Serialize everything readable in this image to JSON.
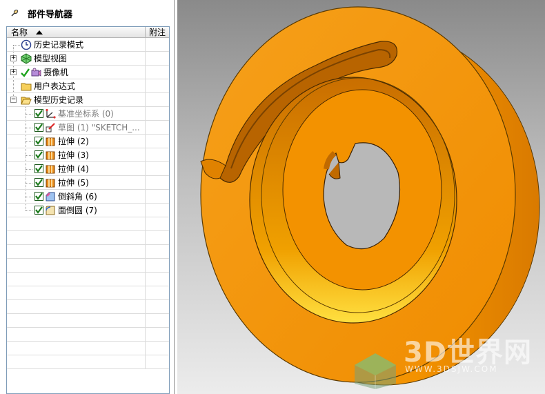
{
  "navigator": {
    "title": "部件导航器",
    "columns": {
      "name": "名称",
      "note": "附注"
    },
    "rows": [
      {
        "label": "历史记录模式",
        "icon": "clock-icon"
      },
      {
        "label": "模型视图",
        "icon": "model-views-icon"
      },
      {
        "label": "摄像机",
        "icon": "camera-icon"
      },
      {
        "label": "用户表达式",
        "icon": "folder-icon"
      },
      {
        "label": "模型历史记录",
        "icon": "folder-open-icon"
      },
      {
        "label": "基准坐标系 (0)",
        "icon": "datum-csys-icon"
      },
      {
        "label": "草图 (1) \"SKETCH_...",
        "icon": "sketch-icon"
      },
      {
        "label": "拉伸 (2)",
        "icon": "extrude-icon"
      },
      {
        "label": "拉伸 (3)",
        "icon": "extrude-icon"
      },
      {
        "label": "拉伸 (4)",
        "icon": "extrude-icon"
      },
      {
        "label": "拉伸 (5)",
        "icon": "extrude-icon"
      },
      {
        "label": "倒斜角 (6)",
        "icon": "chamfer-icon"
      },
      {
        "label": "面倒圆 (7)",
        "icon": "face-blend-icon"
      }
    ]
  },
  "viewport": {
    "part_color": "#F39200",
    "watermark": {
      "brand": "3D世界网",
      "url": "WWW.3DSJW.COM"
    }
  }
}
